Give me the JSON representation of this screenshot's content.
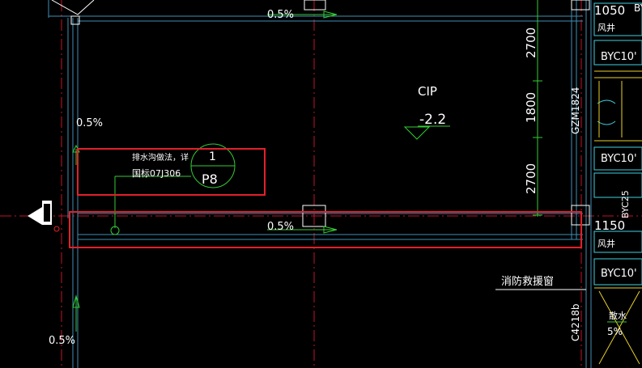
{
  "texts": {
    "slope_top": "0.5%",
    "slope_left_upper": "0.5%",
    "slope_middle": "0.5%",
    "slope_left_lower": "0.5%",
    "elevation_code": "CIP",
    "elevation_value": "-2.2",
    "note_line1": "排水沟做法，详",
    "note_line2": "国标07J306",
    "index_number": "1",
    "index_sheet": "P8",
    "dim_2700_upper": "2700",
    "dim_1800": "1800",
    "dim_2700_lower": "2700",
    "door_label": "GZM1824",
    "dim_1050": "1050",
    "dim_1150": "1150",
    "wind_well_upper": "风井",
    "wind_well_lower": "风井",
    "byc_1": "BYC10'",
    "byc_2": "BYC10'",
    "byc_3": "BYC25",
    "byc_4": "BYC10'",
    "byc_top_partial": "BY",
    "fire_window": "消防救援窗",
    "window_label": "C4218b",
    "drain_label": "散水",
    "drain_slope": "5%"
  },
  "colors": {
    "background": "#000000",
    "wall_line": "#3f8fb6",
    "axis_line": "#c0152a",
    "green": "#33cc33",
    "highlight_box": "#e3202a",
    "text": "#ffffff",
    "cyan": "#3fcfe0",
    "yellow": "#e8d12a"
  }
}
